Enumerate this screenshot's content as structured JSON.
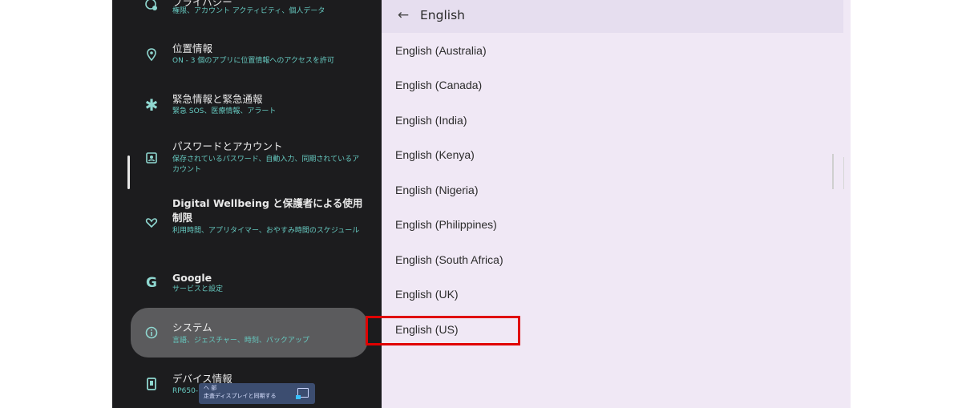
{
  "settings": {
    "items": [
      {
        "title": "プライバシー",
        "sub": "権限、アカウント アクティビティ、個人データ",
        "icon": "privacy-icon"
      },
      {
        "title": "位置情報",
        "sub": "ON - 3 個のアプリに位置情報へのアクセスを許可",
        "icon": "location-icon"
      },
      {
        "title": "緊急情報と緊急通報",
        "sub": "緊急 SOS、医療情報、アラート",
        "icon": "emergency-icon"
      },
      {
        "title": "パスワードとアカウント",
        "sub": "保存されているパスワード、自動入力、同期されているアカウント",
        "icon": "account-icon"
      },
      {
        "title": "Digital Wellbeing と保護者による使用制限",
        "sub": "利用時間、アプリタイマー、おやすみ時間のスケジュール",
        "icon": "wellbeing-icon"
      },
      {
        "title": "Google",
        "sub": "サービスと設定",
        "icon": "google-icon"
      },
      {
        "title": "システム",
        "sub": "言語、ジェスチャー、時刻、バックアップ",
        "icon": "info-icon"
      },
      {
        "title": "デバイス情報",
        "sub": "RP650-",
        "icon": "device-icon"
      }
    ],
    "toast": {
      "line1": "ヘ 部",
      "line2": "走査ディスプレイと同期する"
    }
  },
  "language_panel": {
    "header_title": "English",
    "languages": [
      "English (Australia)",
      "English (Canada)",
      "English (India)",
      "English (Kenya)",
      "English (Nigeria)",
      "English (Philippines)",
      "English (South Africa)",
      "English (UK)",
      "English (US)"
    ]
  },
  "colors": {
    "highlight": "#e00000",
    "left_bg": "#1c1c1e",
    "right_bg": "#f0e8f5",
    "accent_teal": "#66c9c0"
  }
}
